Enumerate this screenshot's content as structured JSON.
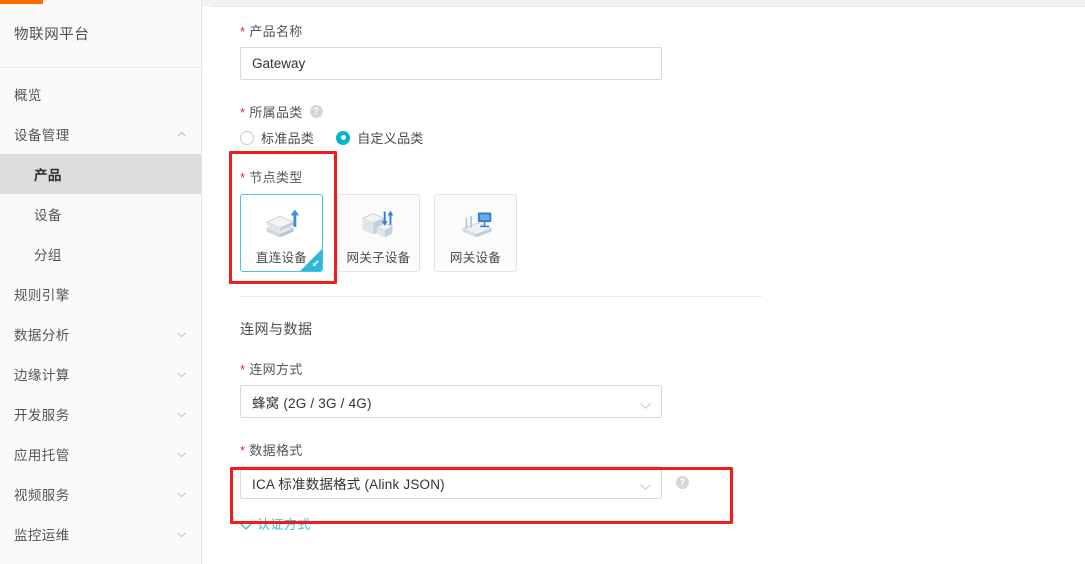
{
  "window": {
    "accent_color": "#ff6a00",
    "highlight_color": "#f01d1d",
    "primary_color": "#00b5cc"
  },
  "sidebar": {
    "brand": "物联网平台",
    "items": [
      {
        "label": "概览",
        "level": 0,
        "chevron": "none",
        "active": false,
        "name": "overview"
      },
      {
        "label": "设备管理",
        "level": 0,
        "chevron": "up",
        "active": false,
        "name": "device-management"
      },
      {
        "label": "产品",
        "level": 1,
        "chevron": "none",
        "active": true,
        "name": "products"
      },
      {
        "label": "设备",
        "level": 1,
        "chevron": "none",
        "active": false,
        "name": "devices"
      },
      {
        "label": "分组",
        "level": 1,
        "chevron": "none",
        "active": false,
        "name": "groups"
      },
      {
        "label": "规则引擎",
        "level": 0,
        "chevron": "none",
        "active": false,
        "name": "rule-engine"
      },
      {
        "label": "数据分析",
        "level": 0,
        "chevron": "down",
        "active": false,
        "name": "data-analysis"
      },
      {
        "label": "边缘计算",
        "level": 0,
        "chevron": "down",
        "active": false,
        "name": "edge-computing"
      },
      {
        "label": "开发服务",
        "level": 0,
        "chevron": "down",
        "active": false,
        "name": "dev-services"
      },
      {
        "label": "应用托管",
        "level": 0,
        "chevron": "down",
        "active": false,
        "name": "app-hosting"
      },
      {
        "label": "视频服务",
        "level": 0,
        "chevron": "down",
        "active": false,
        "name": "video-services"
      },
      {
        "label": "监控运维",
        "level": 0,
        "chevron": "down",
        "active": false,
        "name": "monitoring-ops"
      }
    ]
  },
  "form": {
    "product_name": {
      "label": "产品名称",
      "required": true,
      "value": "Gateway",
      "placeholder": "请输入产品名称"
    },
    "category": {
      "label": "所属品类",
      "required": true,
      "help_icon": "question-icon",
      "options": [
        {
          "label": "标准品类",
          "checked": false
        },
        {
          "label": "自定义品类",
          "checked": true
        }
      ]
    },
    "node_type": {
      "label": "节点类型",
      "required": true,
      "cards": [
        {
          "label": "直连设备",
          "icon": "direct-device-icon",
          "selected": true
        },
        {
          "label": "网关子设备",
          "icon": "gateway-sub-device-icon",
          "selected": false
        },
        {
          "label": "网关设备",
          "icon": "gateway-device-icon",
          "selected": false
        }
      ],
      "selected_badge": "✔"
    },
    "network_section": {
      "title": "连网与数据",
      "network_mode": {
        "label": "连网方式",
        "required": true,
        "value": "蜂窝 (2G / 3G / 4G)"
      },
      "data_format": {
        "label": "数据格式",
        "required": true,
        "value": "ICA 标准数据格式 (Alink JSON)",
        "help_icon": "question-icon"
      }
    },
    "auth_method": {
      "label": "认证方式",
      "chevron": "chevron-down-icon",
      "expanded": false
    },
    "required_marker": "*",
    "help_glyph": "?"
  }
}
